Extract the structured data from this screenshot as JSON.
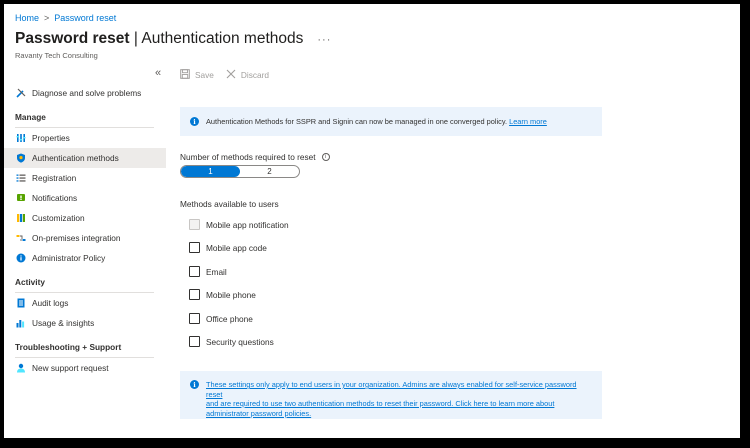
{
  "breadcrumb": {
    "home": "Home",
    "separator": ">",
    "current": "Password reset"
  },
  "header": {
    "title_strong": "Password reset",
    "title_rest": " | Authentication methods",
    "more": "···",
    "org": "Ravanty Tech Consulting",
    "collapse": "«"
  },
  "sidebar": {
    "diagnose": "Diagnose and solve problems",
    "sections": {
      "manage": "Manage",
      "activity": "Activity",
      "support": "Troubleshooting + Support"
    },
    "manage_items": [
      {
        "label": "Properties",
        "icon": "properties-icon"
      },
      {
        "label": "Authentication methods",
        "icon": "shield-icon"
      },
      {
        "label": "Registration",
        "icon": "list-icon"
      },
      {
        "label": "Notifications",
        "icon": "notification-icon"
      },
      {
        "label": "Customization",
        "icon": "customization-icon"
      },
      {
        "label": "On-premises integration",
        "icon": "sync-icon"
      },
      {
        "label": "Administrator Policy",
        "icon": "info-icon"
      }
    ],
    "activity_items": [
      {
        "label": "Audit logs",
        "icon": "audit-log-icon"
      },
      {
        "label": "Usage & insights",
        "icon": "chart-icon"
      }
    ],
    "support_items": [
      {
        "label": "New support request",
        "icon": "person-icon"
      }
    ]
  },
  "toolbar": {
    "save": "Save",
    "discard": "Discard"
  },
  "info_top": {
    "text": "Authentication Methods for SSPR and Signin can now be managed in one converged policy. ",
    "link": "Learn more"
  },
  "methods_required": {
    "label": "Number of methods required to reset",
    "options": [
      "1",
      "2"
    ],
    "selected": "1"
  },
  "methods_available": {
    "label": "Methods available to users",
    "items": [
      {
        "label": "Mobile app notification",
        "checked": false,
        "disabled": true
      },
      {
        "label": "Mobile app code",
        "checked": false,
        "disabled": false
      },
      {
        "label": "Email",
        "checked": false,
        "disabled": false
      },
      {
        "label": "Mobile phone",
        "checked": false,
        "disabled": false
      },
      {
        "label": "Office phone",
        "checked": false,
        "disabled": false
      },
      {
        "label": "Security questions",
        "checked": false,
        "disabled": false
      }
    ]
  },
  "info_bottom": {
    "line1": "These settings only apply to end users in your organization. Admins are always enabled for self-service password reset",
    "line2": "and are required to use two authentication methods to reset their password. Click here to learn more about",
    "line3": "administrator password policies."
  },
  "colors": {
    "accent": "#0078d4",
    "info_bg": "#ebf3fc",
    "active_nav": "#edebe9"
  }
}
